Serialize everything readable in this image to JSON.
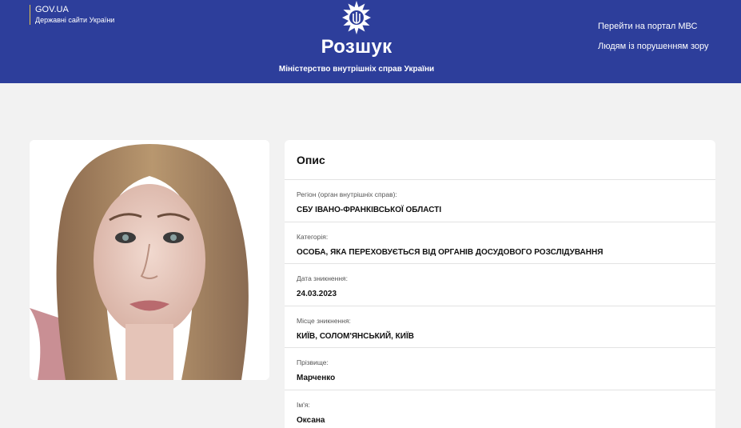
{
  "header": {
    "gov_title": "GOV.UA",
    "gov_subtitle": "Державні сайти України",
    "title": "Розшук",
    "ministry": "Міністерство внутрішніх справ України",
    "links": [
      {
        "label": "Перейти на портал МВС"
      },
      {
        "label": "Людям із порушенням зору"
      }
    ]
  },
  "description": {
    "title": "Опис",
    "fields": [
      {
        "label": "Регіон (орган внутрішніх справ):",
        "value": "СБУ ІВАНО-ФРАНКІВСЬКОЇ ОБЛАСТІ"
      },
      {
        "label": "Категорія:",
        "value": "ОСОБА, ЯКА ПЕРЕХОВУЄТЬСЯ ВІД ОРГАНІВ ДОСУДОВОГО РОЗСЛІДУВАННЯ"
      },
      {
        "label": "Дата зникнення:",
        "value": "24.03.2023"
      },
      {
        "label": "Місце зникнення:",
        "value": "КИЇВ, СОЛОМ'ЯНСЬКИЙ, КИЇВ"
      },
      {
        "label": "Прізвище:",
        "value": "Марченко"
      },
      {
        "label": "Ім'я:",
        "value": "Оксана"
      }
    ]
  },
  "colors": {
    "header_bg": "#2d3e9b",
    "page_bg": "#f2f2f2",
    "accent_line": "#e7c64a"
  },
  "icons": {
    "emblem": "police-emblem-icon"
  }
}
